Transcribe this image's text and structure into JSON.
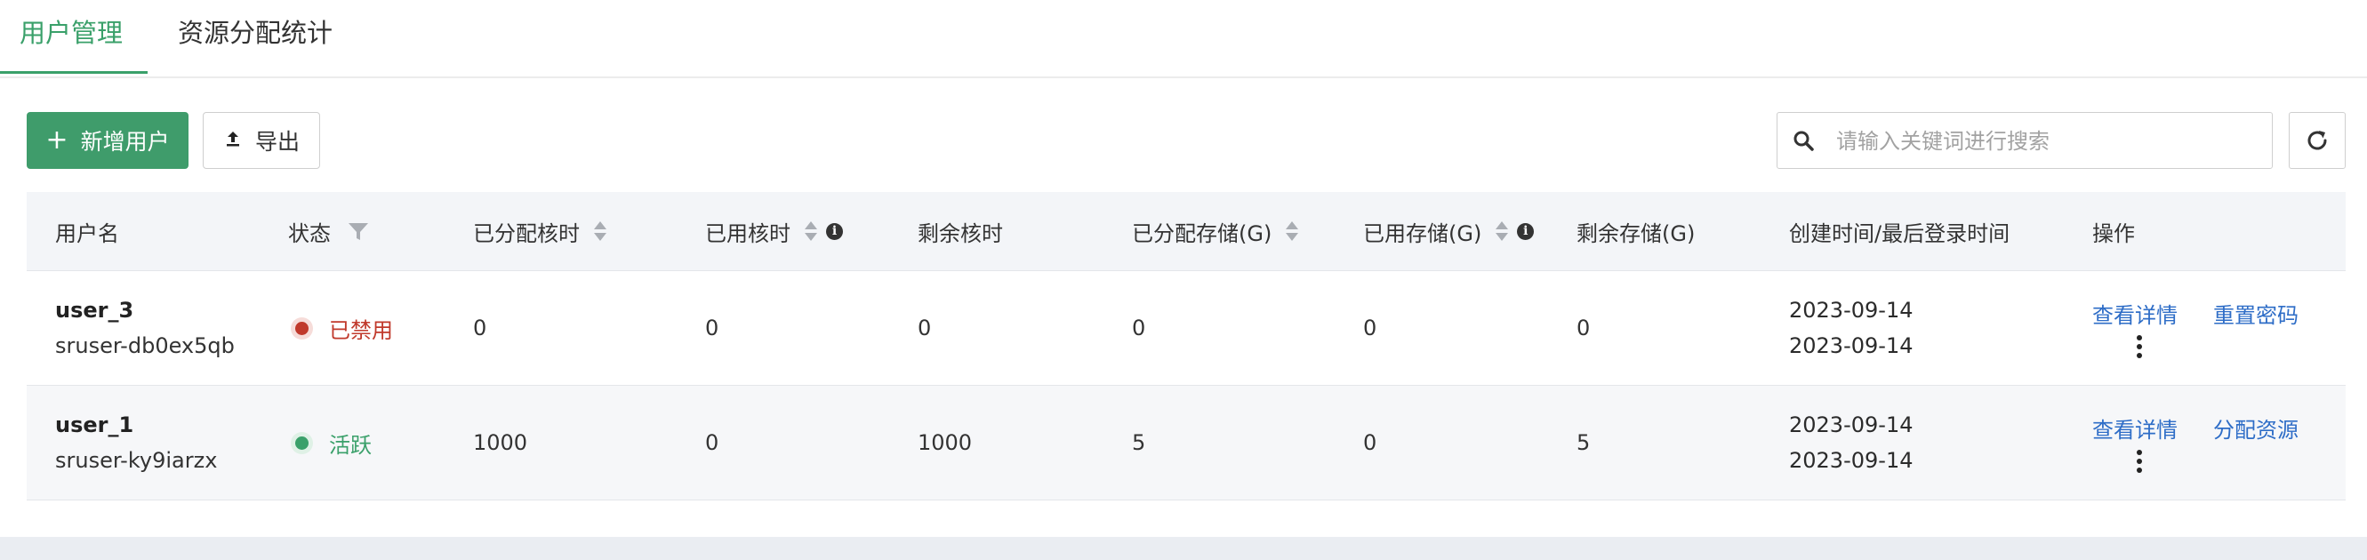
{
  "tabs": [
    {
      "label": "用户管理",
      "active": true
    },
    {
      "label": "资源分配统计",
      "active": false
    }
  ],
  "toolbar": {
    "add_user_label": "新增用户",
    "add_icon": "plus-icon",
    "export_label": "导出",
    "export_icon": "upload-icon",
    "search_placeholder": "请输入关键词进行搜索",
    "search_value": "",
    "refresh_icon": "refresh-icon"
  },
  "columns": {
    "username": "用户名",
    "status": "状态",
    "allocated_core_hours": "已分配核时",
    "used_core_hours": "已用核时",
    "remaining_core_hours": "剩余核时",
    "allocated_storage": "已分配存储(G)",
    "used_storage": "已用存储(G)",
    "remaining_storage": "剩余存储(G)",
    "time": "创建时间/最后登录时间",
    "actions": "操作"
  },
  "rows": [
    {
      "username": "user_3",
      "account": "sruser-db0ex5qb",
      "status": "已禁用",
      "status_color": "#c0392b",
      "allocated_core_hours": "0",
      "used_core_hours": "0",
      "remaining_core_hours": "0",
      "allocated_storage": "0",
      "used_storage": "0",
      "remaining_storage": "0",
      "created": "2023-09-14",
      "last_login": "2023-09-14",
      "action_1": "查看详情",
      "action_2": "重置密码"
    },
    {
      "username": "user_1",
      "account": "sruser-ky9iarzx",
      "status": "活跃",
      "status_color": "#3aa06a",
      "allocated_core_hours": "1000",
      "used_core_hours": "0",
      "remaining_core_hours": "1000",
      "allocated_storage": "5",
      "used_storage": "0",
      "remaining_storage": "5",
      "created": "2023-09-14",
      "last_login": "2023-09-14",
      "action_1": "查看详情",
      "action_2": "分配资源"
    }
  ],
  "colors": {
    "accent": "#3f9c6b",
    "link": "#2e6dc7",
    "disabled": "#c0392b",
    "active": "#3aa06a",
    "header_bg": "#f3f5f8"
  }
}
